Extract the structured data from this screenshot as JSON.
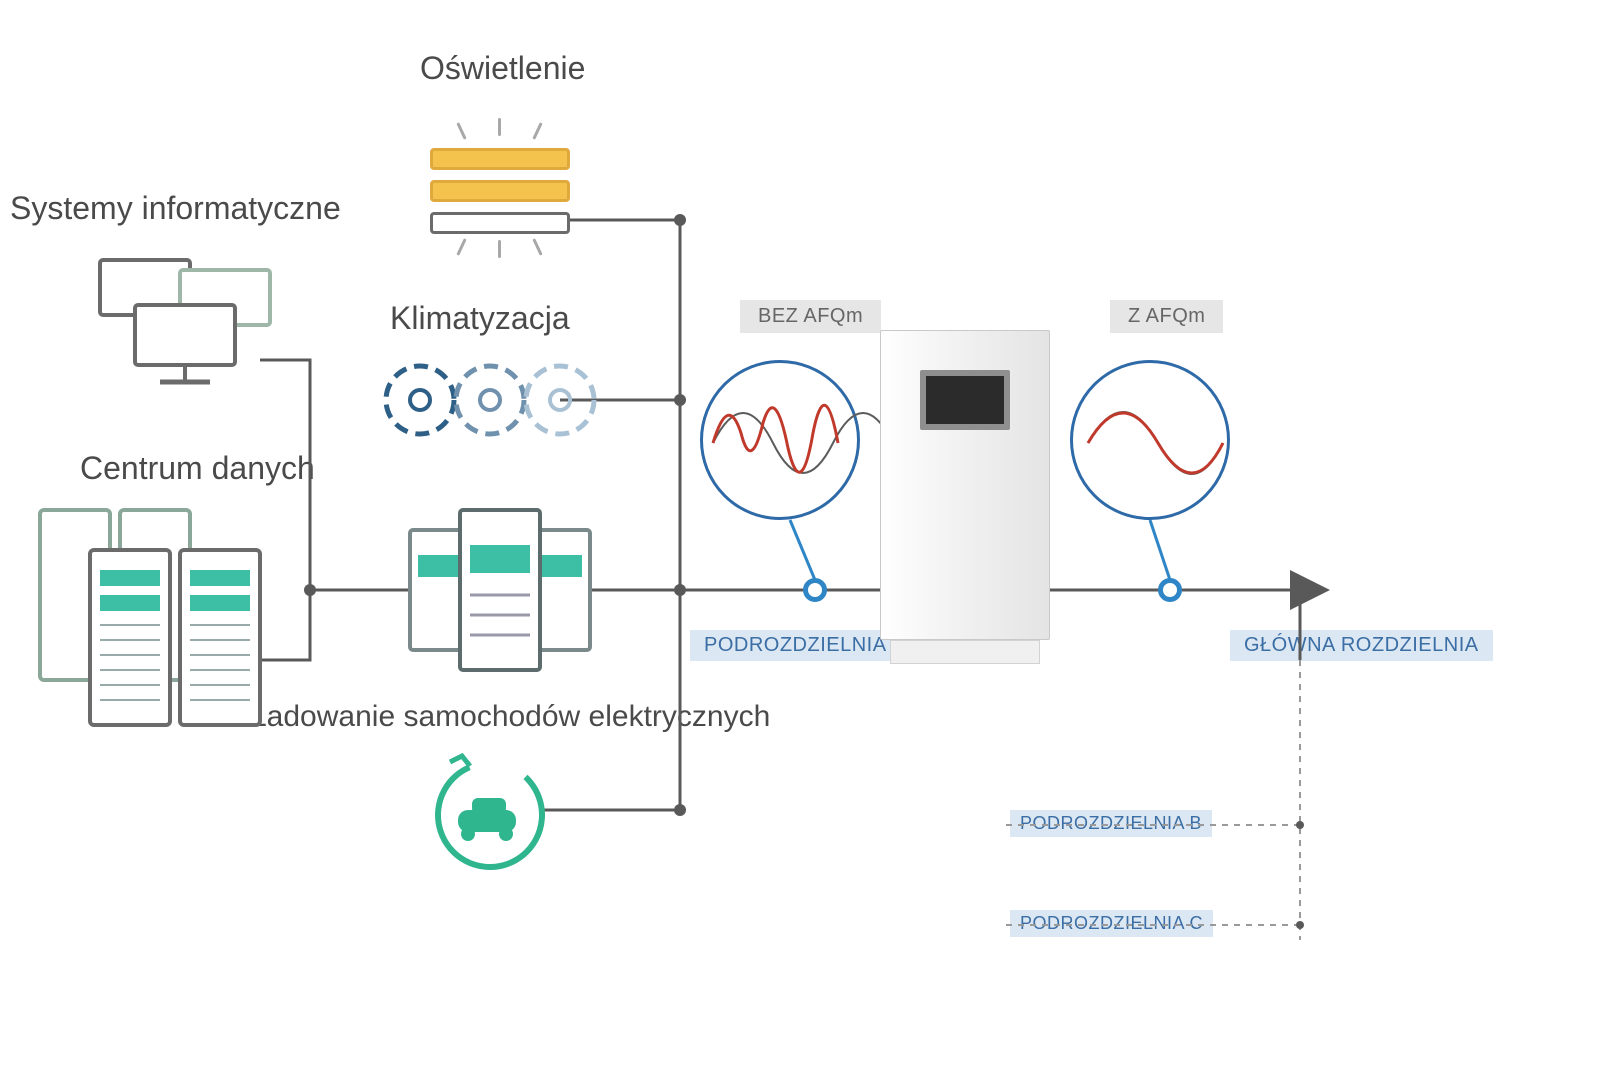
{
  "labels": {
    "lighting": "Oświetlenie",
    "it_systems": "Systemy informatyczne",
    "hvac": "Klimatyzacja",
    "data_center": "Centrum danych",
    "ev_charging": "Ładowanie samochodów elektrycznych"
  },
  "tags": {
    "without_afqm": "BEZ AFQm",
    "with_afqm": "Z AFQm",
    "sub_a": "PODROZDZIELNIA A",
    "sub_b": "PODROZDZIELNIA B",
    "sub_c": "PODROZDZIELNIA C",
    "main_switchboard": "GŁÓWNA ROZDZIELNIA"
  },
  "colors": {
    "wire": "#595959",
    "tag_bg": "#dbe7f3",
    "tag_fg": "#3b6ea5",
    "wave_red": "#c0392b",
    "wave_blue": "#2f6aa8",
    "accent_teal": "#3cbfa4",
    "accent_yellow": "#f3c34d"
  }
}
